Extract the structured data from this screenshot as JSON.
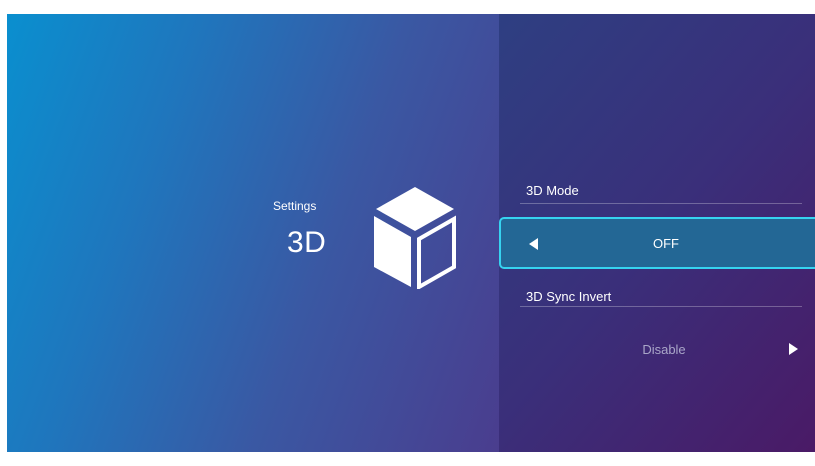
{
  "header": {
    "category": "Settings",
    "title": "3D",
    "icon": "cube-icon"
  },
  "options": [
    {
      "label": "3D Mode",
      "value": "OFF",
      "active": true,
      "arrow": "arrow-left-icon"
    },
    {
      "label": "3D Sync Invert",
      "value": "Disable",
      "active": false,
      "arrow": "arrow-right-icon"
    }
  ],
  "colors": {
    "focus_border": "#36d3f0",
    "focus_fill": "#236795",
    "inactive_value": "#a9a6c8",
    "text": "#ffffff"
  }
}
